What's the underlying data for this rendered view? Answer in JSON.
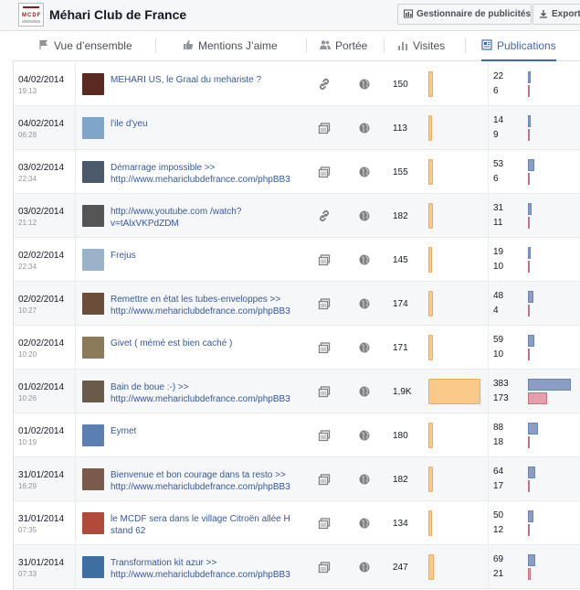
{
  "header": {
    "title": "Méhari Club de France",
    "ads_manager_label": "Gestionnaire de publicités",
    "export_label": "Exporter"
  },
  "tabs": [
    {
      "label": "Vue d’ensemble",
      "icon": "flag-icon"
    },
    {
      "label": "Mentions J’aime",
      "icon": "thumbs-up-icon"
    },
    {
      "label": "Portée",
      "icon": "people-icon"
    },
    {
      "label": "Visites",
      "icon": "bar-chart-icon"
    },
    {
      "label": "Publications",
      "icon": "posts-icon"
    }
  ],
  "active_tab": "Publications",
  "colors": {
    "reach_bar": "#fbc98a",
    "clicks_bar": "#8b9dc3",
    "interactions_bar": "#e3a0ac",
    "link": "#365899",
    "accent": "#4267b2"
  },
  "posts": [
    {
      "date": "04/02/2014",
      "time": "19:13",
      "text": "MEHARI US, le Graal du mehariste ?",
      "type_icon": "link-icon",
      "reach": "150",
      "reach_value": 150,
      "clicks": "22",
      "clicks_value": 22,
      "interactions": "6",
      "interactions_value": 6,
      "thumb_color": "#5a2a1e"
    },
    {
      "date": "04/02/2014",
      "time": "06:28",
      "text": "l'ile d'yeu",
      "type_icon": "photo-icon",
      "reach": "113",
      "reach_value": 113,
      "clicks": "14",
      "clicks_value": 14,
      "interactions": "9",
      "interactions_value": 9,
      "thumb_color": "#7fa6c9"
    },
    {
      "date": "03/02/2014",
      "time": "22:34",
      "text": "Démarrage impossible >> http://www.mehariclubdefrance.com/phpBB3",
      "type_icon": "photo-icon",
      "reach": "155",
      "reach_value": 155,
      "clicks": "53",
      "clicks_value": 53,
      "interactions": "6",
      "interactions_value": 6,
      "thumb_color": "#4a5a6a"
    },
    {
      "date": "03/02/2014",
      "time": "21:12",
      "text": "http://www.youtube.com /watch?v=tAlxVKPdZDM",
      "type_icon": "link-icon",
      "reach": "182",
      "reach_value": 182,
      "clicks": "31",
      "clicks_value": 31,
      "interactions": "11",
      "interactions_value": 11,
      "thumb_color": "#555555"
    },
    {
      "date": "02/02/2014",
      "time": "22:34",
      "text": "Frejus",
      "type_icon": "photo-icon",
      "reach": "145",
      "reach_value": 145,
      "clicks": "19",
      "clicks_value": 19,
      "interactions": "10",
      "interactions_value": 10,
      "thumb_color": "#9bb3c9"
    },
    {
      "date": "02/02/2014",
      "time": "10:27",
      "text": "Remettre en état les tubes-enveloppes >> http://www.mehariclubdefrance.com/phpBB3",
      "type_icon": "photo-icon",
      "reach": "174",
      "reach_value": 174,
      "clicks": "48",
      "clicks_value": 48,
      "interactions": "4",
      "interactions_value": 4,
      "thumb_color": "#6b4e3a"
    },
    {
      "date": "02/02/2014",
      "time": "10:20",
      "text": "Givet ( mémé est bien caché )",
      "type_icon": "photo-icon",
      "reach": "171",
      "reach_value": 171,
      "clicks": "59",
      "clicks_value": 59,
      "interactions": "10",
      "interactions_value": 10,
      "thumb_color": "#8a7a5a"
    },
    {
      "date": "01/02/2014",
      "time": "10:26",
      "text": "Bain de boue :-) >> http://www.mehariclubdefrance.com/phpBB3",
      "type_icon": "photo-icon",
      "reach": "1,9K",
      "reach_value": 1900,
      "clicks": "383",
      "clicks_value": 383,
      "interactions": "173",
      "interactions_value": 173,
      "thumb_color": "#6a5a48"
    },
    {
      "date": "01/02/2014",
      "time": "10:19",
      "text": "Eymet",
      "type_icon": "photo-icon",
      "reach": "180",
      "reach_value": 180,
      "clicks": "88",
      "clicks_value": 88,
      "interactions": "18",
      "interactions_value": 18,
      "thumb_color": "#5b7fb0"
    },
    {
      "date": "31/01/2014",
      "time": "16:29",
      "text": "Bienvenue et bon courage dans ta resto >> http://www.mehariclubdefrance.com/phpBB3",
      "type_icon": "photo-icon",
      "reach": "182",
      "reach_value": 182,
      "clicks": "64",
      "clicks_value": 64,
      "interactions": "17",
      "interactions_value": 17,
      "thumb_color": "#7a5a48"
    },
    {
      "date": "31/01/2014",
      "time": "07:35",
      "text": "le MCDF sera dans le village Citroën allée H stand 62",
      "type_icon": "photo-icon",
      "reach": "134",
      "reach_value": 134,
      "clicks": "50",
      "clicks_value": 50,
      "interactions": "12",
      "interactions_value": 12,
      "thumb_color": "#b04a3a"
    },
    {
      "date": "31/01/2014",
      "time": "07:33",
      "text": "Transformation kit azur >> http://www.mehariclubdefrance.com/phpBB3",
      "type_icon": "photo-icon",
      "reach": "247",
      "reach_value": 247,
      "clicks": "69",
      "clicks_value": 69,
      "interactions": "21",
      "interactions_value": 21,
      "thumb_color": "#3e6fa3"
    }
  ]
}
